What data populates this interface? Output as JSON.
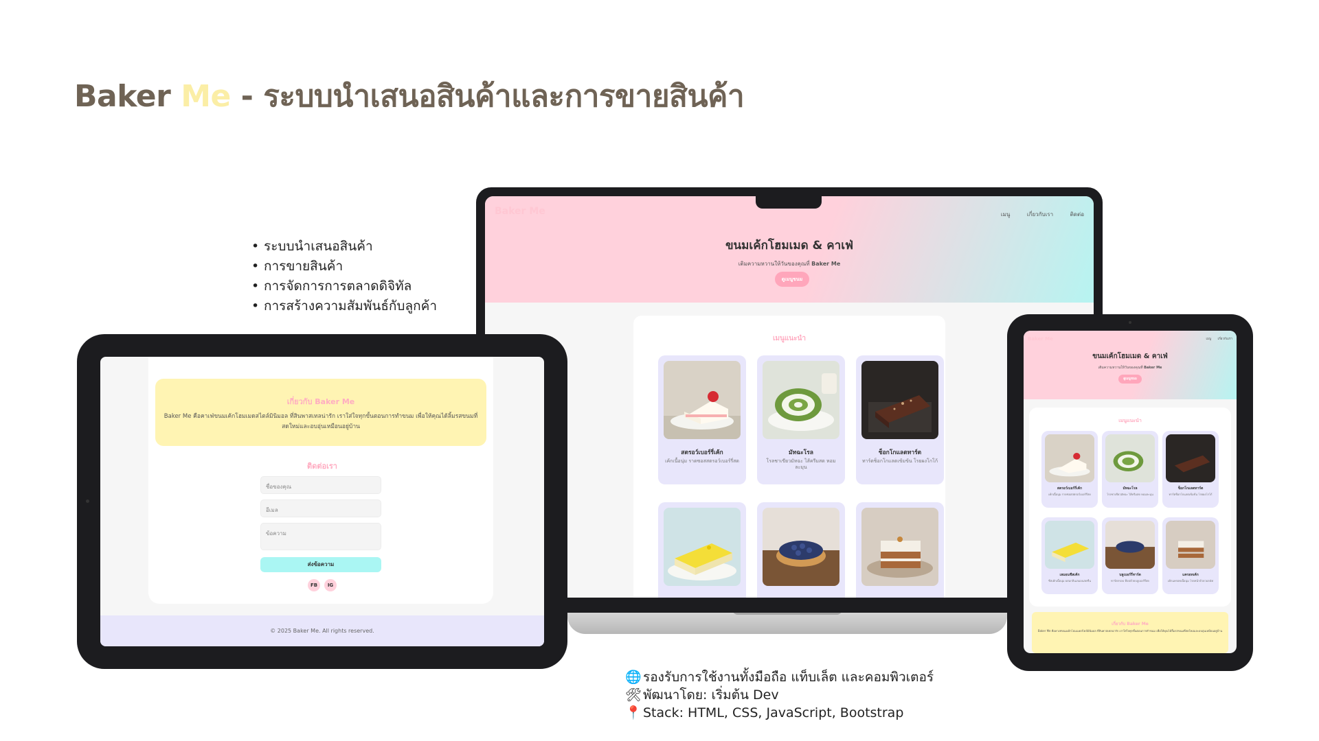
{
  "title": {
    "brand_part1": "Baker",
    "brand_part2": "Me",
    "rest": " - ระบบนำเสนอสินค้าและการขายสินค้า"
  },
  "features": [
    "ระบบนำเสนอสินค้า",
    "การขายสินค้า",
    "การจัดการการตลาดดิจิทัล",
    "การสร้างความสัมพันธ์กับลูกค้า"
  ],
  "credits": [
    {
      "icon": "🌐",
      "icon_name": "globe-icon",
      "text": "รองรับการใช้งานทั้งมือถือ แท็บเล็ต และคอมพิวเตอร์"
    },
    {
      "icon": "🛠",
      "icon_name": "tools-icon",
      "text": "พัฒนาโดย: เริ่มต้น Dev"
    },
    {
      "icon": "📍",
      "icon_name": "pin-icon",
      "text": "Stack: HTML, CSS, JavaScript, Bootstrap"
    }
  ],
  "site": {
    "brand": "Baker Me",
    "nav": [
      "เมนู",
      "เกี่ยวกับเรา",
      "ติดต่อ"
    ],
    "hero_title": "ขนมเค้กโฮมเมด & คาเฟ่",
    "hero_sub_prefix": "เติมความหวานให้วันของคุณที่ ",
    "hero_sub_brand": "Baker Me",
    "hero_button": "ดูเมนูขนม",
    "menu_title": "เมนูแนะนำ",
    "products": [
      {
        "name": "สตรอว์เบอร์รี่เค้ก",
        "desc": "เค้กเนื้อนุ่ม ราดซอสสตรอว์เบอร์รี่สด",
        "image": "strawberry-cake"
      },
      {
        "name": "มัทฉะโรล",
        "desc": "โรลชาเขียวมัทฉะ ไส้ครีมสด หอมละมุน",
        "image": "matcha-roll"
      },
      {
        "name": "ช็อกโกแลตทาร์ต",
        "desc": "ทาร์ตช็อกโกแลตเข้มข้น โรยผงโกโก้",
        "image": "chocolate-tart"
      },
      {
        "name": "เลมอนชีสเค้ก",
        "desc": "ชีสเค้กเนื้อนุ่ม ผสมกลิ่นเลมอนสดชื่น",
        "image": "lemon-cheesecake"
      },
      {
        "name": "บลูเบอร์รี่ทาร์ต",
        "desc": "ทาร์ตกรอบ ท็อปด้วยบลูเบอร์รี่สด",
        "image": "blueberry-tart"
      },
      {
        "name": "แครอทเค้ก",
        "desc": "เค้กแครอทเนื้อนุ่ม โรยหน้าด้วยวอลนัท",
        "image": "carrot-cake"
      }
    ],
    "about_title": "เกี่ยวกับ Baker Me",
    "about_text": "Baker Me คือคาเฟ่ขนมเค้กโฮมเมดสไตล์มินิมอล ที่สินพาสเทลน่ารัก เราใส่ใจทุกขั้นตอนการทำขนม เพื่อให้คุณได้ลิ้มรสขนมที่สดใหม่และอบอุ่นเหมือนอยู่บ้าน",
    "contact_title": "ติดต่อเรา",
    "contact_name_placeholder": "ชื่อของคุณ",
    "contact_email_placeholder": "อีเมล",
    "contact_message_placeholder": "ข้อความ",
    "contact_send": "ส่งข้อความ",
    "social": [
      "FB",
      "IG"
    ],
    "footer": "© 2025 Baker Me. All rights reserved."
  },
  "colors": {
    "accent_pink": "#ffadc2",
    "pastel_yellow": "#fff4b3",
    "pastel_mint": "#aaf6f3",
    "pastel_lavender": "#e8e6fb",
    "title_brown": "#6f6355"
  }
}
